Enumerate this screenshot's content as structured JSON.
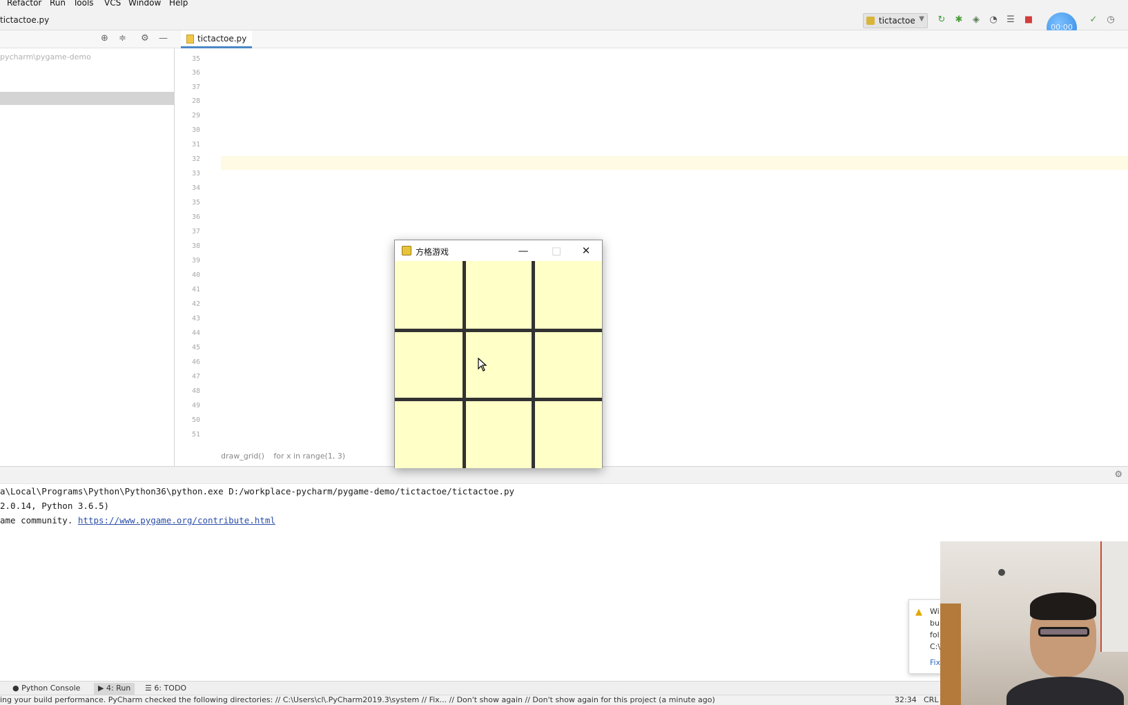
{
  "menu": {
    "items": [
      "Refactor",
      "Run",
      "Tools",
      "VCS",
      "Window",
      "Help"
    ]
  },
  "navbar": {
    "file_crumb": "tictactoe.py",
    "run_config": "tictactoe",
    "avatar_text": "00:00"
  },
  "project": {
    "path": "pycharm\\pygame-demo"
  },
  "editor": {
    "tab_label": "tictactoe.py",
    "line_numbers": [
      "35",
      "36",
      "37",
      "28",
      "29",
      "30",
      "31",
      "32",
      "33",
      "34",
      "35",
      "36",
      "37",
      "38",
      "39",
      "40",
      "41",
      "42",
      "43",
      "44",
      "45",
      "46",
      "47",
      "48",
      "49",
      "50",
      "51"
    ],
    "breadcrumb": [
      "draw_grid()",
      "for x in range(1, 3)"
    ]
  },
  "game_window": {
    "title": "方格游戏",
    "minimize": "—",
    "maximize": "□",
    "close": "✕"
  },
  "run_output": {
    "line1": "a\\Local\\Programs\\Python\\Python36\\python.exe D:/workplace-pycharm/pygame-demo/tictactoe/tictactoe.py",
    "line2": "2.0.14, Python 3.6.5)",
    "line3_prefix": "ame community. ",
    "line3_link": "https://www.pygame.org/contribute.html"
  },
  "tool_windows": {
    "python_console": "Python Console",
    "run": "4: Run",
    "todo": "6: TODO"
  },
  "status": {
    "message": "ing your build performance. PyCharm checked the following directories: // C:\\Users\\cl\\.PyCharm2019.3\\system // Fix... // Don't show again // Don't show again for this project (a minute ago)",
    "position": "32:34",
    "line_sep": "CRL"
  },
  "notification": {
    "lines": [
      "Wi",
      "bu",
      "fol",
      "C:\\",
      "Fix"
    ]
  },
  "colors": {
    "board_bg": "#ffffc8",
    "grid_line": "#323232",
    "link": "#2b4ea8",
    "keyword": "#000080",
    "number": "#0000ff"
  }
}
